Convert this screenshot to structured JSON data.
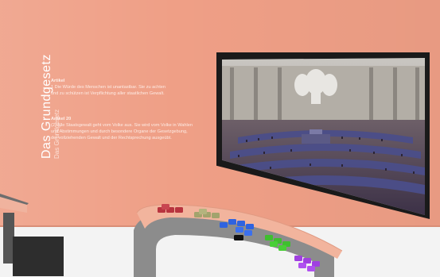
{
  "exhibit": {
    "title": "Das Grundgesetz",
    "subtitle": "Das Grundgesetz",
    "article_1": {
      "heading": "Artikel",
      "lines": [
        "1 Die Würde des Menschen ist unantastbar. Sie zu achten",
        "und zu schützen ist Verpflichtung aller staatlichen Gewalt."
      ]
    },
    "article_2": {
      "heading": "Artikel 20",
      "lines": [
        "(2) Alle Staatsgewalt geht vom Volke aus. Sie wird vom Volke in Wahlen",
        "und Abstimmungen und durch besondere Organe der Gesetzgebung,",
        "der vollziehenden Gewalt und der Rechtsprechung ausgeübt."
      ]
    }
  },
  "screen": {
    "content": "Bundestag plenary hall with federal eagle"
  },
  "console": {
    "button_groups": [
      {
        "name": "red-button-group",
        "color": "#b8343f"
      },
      {
        "name": "olive-button-group",
        "color": "#a3a36d"
      },
      {
        "name": "blue-button-group",
        "color": "#2f63e0"
      },
      {
        "name": "green-button-group",
        "color": "#3fbf2f"
      },
      {
        "name": "purple-button-group",
        "color": "#a040e0"
      }
    ],
    "indicator_color": "#111111"
  },
  "colors": {
    "wall": "#ef9f86",
    "desk": "#f2b49d",
    "desk_base": "#8a8a8a"
  }
}
